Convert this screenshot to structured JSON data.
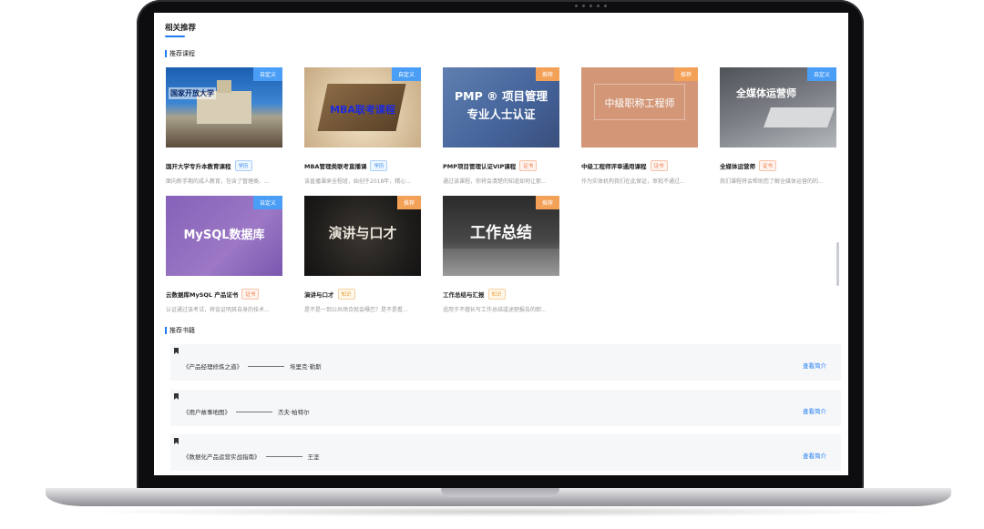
{
  "page": {
    "title": "相关推荐",
    "section_courses": "推荐课程",
    "section_books": "推荐书籍"
  },
  "colors": {
    "accent": "#1e7cf2",
    "tag_blue": "#4a9ef6",
    "tag_orange": "#f4a158"
  },
  "courses": [
    {
      "tag": "自定义",
      "thumb_text": "",
      "title": "国开大学专升本教育课程",
      "badge": "学历",
      "desc": "面向新手期的成人教育，包含了管理类、..."
    },
    {
      "tag": "自定义",
      "thumb_text": "MBA联考课程",
      "title": "MBA管理类联考直播课",
      "badge": "学历",
      "desc": "该直播课来全程班，始创于2018年，精心..."
    },
    {
      "tag": "推荐",
      "thumb_text": "PMP ® 项目管理 专业人士认证",
      "title": "PMP项目管理认证VIP课程",
      "badge": "证书",
      "desc": "通过该课程，你将会清楚的知道如何让那..."
    },
    {
      "tag": "推荐",
      "thumb_text": "中级职称工程师",
      "title": "中级工程师评审通用课程",
      "badge": "证书",
      "desc": "作为实体机构我们在此保证，审批不通过..."
    },
    {
      "tag": "自定义",
      "thumb_text": "全媒体运营师",
      "title": "全媒体运营师",
      "badge": "证书",
      "desc": "我们课程将会帮助您了解全媒体运营的的..."
    },
    {
      "tag": "自定义",
      "thumb_text": "MySQL数据库",
      "title": "云数据库MySQL 产品证书",
      "badge": "证书",
      "desc": "认证通过该考试，将会证明其自身的技术..."
    },
    {
      "tag": "推荐",
      "thumb_text": "演讲与口才",
      "title": "演讲与口才",
      "badge": "知识",
      "desc": "是不是一到公共场合就会嗫巴？是不是看..."
    },
    {
      "tag": "推荐",
      "thumb_text": "工作总结",
      "title": "工作总结与汇报",
      "badge": "知识",
      "desc": "适用于不擅长写工作总结或述职报告的职..."
    }
  ],
  "thumb_overlays": {
    "campus_text": "国家开放大学"
  },
  "books": [
    {
      "name": "《产品经理修炼之道》",
      "author": "埃里克·勒斯",
      "link": "查看简介"
    },
    {
      "name": "《用户故事地图》",
      "author": "杰夫·帕特尔",
      "link": "查看简介"
    },
    {
      "name": "《数据化产品运营实战指南》",
      "author": "王坚",
      "link": "查看简介"
    }
  ]
}
